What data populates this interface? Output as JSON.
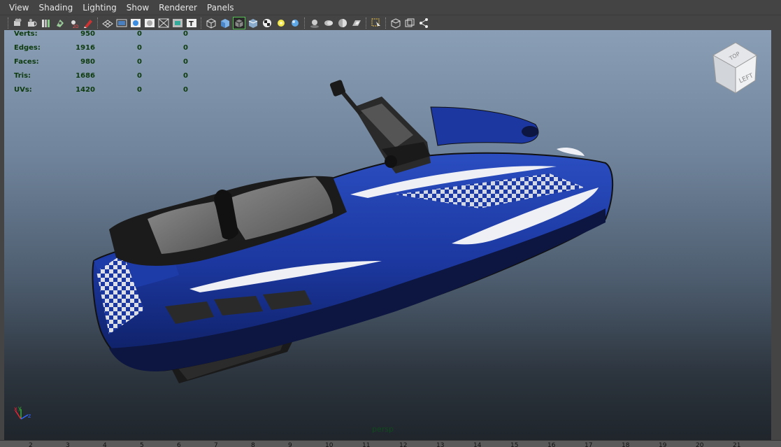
{
  "menubar": {
    "items": [
      "View",
      "Shading",
      "Lighting",
      "Show",
      "Renderer",
      "Panels"
    ]
  },
  "toolbar": {
    "groups": [
      [
        "camera-select-icon",
        "camera-attr-icon",
        "bookmarks-icon",
        "image-plane-icon",
        "two-d-pan-icon",
        "grease-pencil-icon"
      ],
      [
        "grid-icon",
        "film-gate-icon",
        "resolution-gate-icon",
        "gate-mask-icon",
        "field-chart-icon",
        "safe-action-icon",
        "safe-title-icon"
      ],
      [
        "wireframe-icon",
        "smooth-shade-icon",
        "wireframe-on-shaded-icon",
        "xray-icon",
        "use-default-material-icon",
        "use-all-lights-icon",
        "shadows-icon"
      ],
      [
        "screen-space-ao-icon",
        "motion-blur-icon",
        "multisample-aa-icon",
        "depth-of-field-icon"
      ],
      [
        "isolate-select-icon"
      ],
      [
        "xray-joints-icon",
        "xray-active-components-icon",
        "toggle-hud-icon"
      ]
    ]
  },
  "hud": {
    "rows": [
      {
        "label": "Verts:",
        "v1": "950",
        "v2": "0",
        "v3": "0"
      },
      {
        "label": "Edges:",
        "v1": "1916",
        "v2": "0",
        "v3": "0"
      },
      {
        "label": "Faces:",
        "v1": "980",
        "v2": "0",
        "v3": "0"
      },
      {
        "label": "Tris:",
        "v1": "1686",
        "v2": "0",
        "v3": "0"
      },
      {
        "label": "UVs:",
        "v1": "1420",
        "v2": "0",
        "v3": "0"
      }
    ]
  },
  "viewcube": {
    "face_front": "LEFT",
    "face_top": "TOP"
  },
  "viewport": {
    "camera_name": "persp"
  },
  "axis": {
    "x": "x",
    "y": "y",
    "z": "z"
  },
  "timeline": {
    "ticks": [
      "2",
      "3",
      "4",
      "5",
      "6",
      "7",
      "8",
      "9",
      "10",
      "11",
      "12",
      "13",
      "14",
      "15",
      "16",
      "17",
      "18",
      "19",
      "20",
      "21"
    ]
  },
  "colors": {
    "hud_text": "#0e3b0e",
    "hull_blue": "#1f3fa6",
    "seat_gray": "#6d6d6d"
  }
}
